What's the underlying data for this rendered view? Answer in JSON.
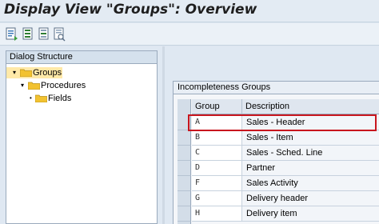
{
  "window": {
    "title": "Display View \"Groups\": Overview"
  },
  "toolbar": {
    "buttons": [
      {
        "icon": "details-icon"
      },
      {
        "icon": "select-all-icon"
      },
      {
        "icon": "select-block-icon"
      },
      {
        "icon": "deselect-all-icon"
      }
    ]
  },
  "dialog_structure": {
    "header": "Dialog Structure",
    "nodes": [
      {
        "label": "Groups",
        "toggle": "▾",
        "selected": true
      },
      {
        "label": "Procedures",
        "toggle": "▾",
        "selected": false
      },
      {
        "label": "Fields",
        "toggle": "•",
        "selected": false
      }
    ]
  },
  "table": {
    "title": "Incompleteness Groups",
    "columns": [
      "Group",
      "Description"
    ],
    "rows": [
      {
        "group": "A",
        "description": "Sales - Header"
      },
      {
        "group": "B",
        "description": "Sales - Item"
      },
      {
        "group": "C",
        "description": "Sales - Sched. Line"
      },
      {
        "group": "D",
        "description": "Partner"
      },
      {
        "group": "F",
        "description": "Sales Activity"
      },
      {
        "group": "G",
        "description": "Delivery header"
      },
      {
        "group": "H",
        "description": "Delivery item"
      }
    ],
    "highlight_color": "#c8161e"
  },
  "colors": {
    "folder": "#f2c230",
    "selection": "#ffe9a8"
  }
}
